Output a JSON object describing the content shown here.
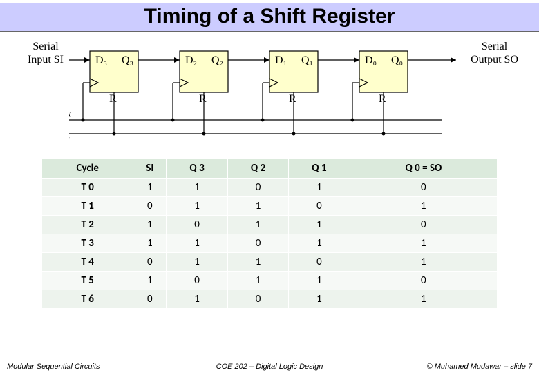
{
  "title": "Timing of a Shift Register",
  "labels": {
    "si_l1": "Serial",
    "si_l2": "Input SI",
    "so_l1": "Serial",
    "so_l2": "Output SO",
    "clock": "Clock",
    "reset": "Reset",
    "R": "R"
  },
  "ff": [
    {
      "d": "D₃",
      "q": "Q₃"
    },
    {
      "d": "D₂",
      "q": "Q₂"
    },
    {
      "d": "D₁",
      "q": "Q₁"
    },
    {
      "d": "D₀",
      "q": "Q₀"
    }
  ],
  "table": {
    "headers": [
      "Cycle",
      "SI",
      "Q 3",
      "Q 2",
      "Q 1",
      "Q 0 = SO"
    ],
    "rows": [
      [
        "T 0",
        "1",
        "1",
        "0",
        "1",
        "0"
      ],
      [
        "T 1",
        "0",
        "1",
        "1",
        "0",
        "1"
      ],
      [
        "T 2",
        "1",
        "0",
        "1",
        "1",
        "0"
      ],
      [
        "T 3",
        "1",
        "1",
        "0",
        "1",
        "1"
      ],
      [
        "T 4",
        "0",
        "1",
        "1",
        "0",
        "1"
      ],
      [
        "T 5",
        "1",
        "0",
        "1",
        "1",
        "0"
      ],
      [
        "T 6",
        "0",
        "1",
        "0",
        "1",
        "1"
      ]
    ]
  },
  "footer": {
    "left": "Modular Sequential Circuits",
    "center": "COE 202 – Digital Logic Design",
    "right": "© Muhamed Mudawar – slide 7"
  },
  "chart_data": {
    "type": "table",
    "title": "Timing of a Shift Register",
    "columns": [
      "Cycle",
      "SI",
      "Q3",
      "Q2",
      "Q1",
      "Q0=SO"
    ],
    "rows": [
      [
        "T0",
        1,
        1,
        0,
        1,
        0
      ],
      [
        "T1",
        0,
        1,
        1,
        0,
        1
      ],
      [
        "T2",
        1,
        0,
        1,
        1,
        0
      ],
      [
        "T3",
        1,
        1,
        0,
        1,
        1
      ],
      [
        "T4",
        0,
        1,
        1,
        0,
        1
      ],
      [
        "T5",
        1,
        0,
        1,
        1,
        0
      ],
      [
        "T6",
        0,
        1,
        0,
        1,
        1
      ]
    ]
  }
}
